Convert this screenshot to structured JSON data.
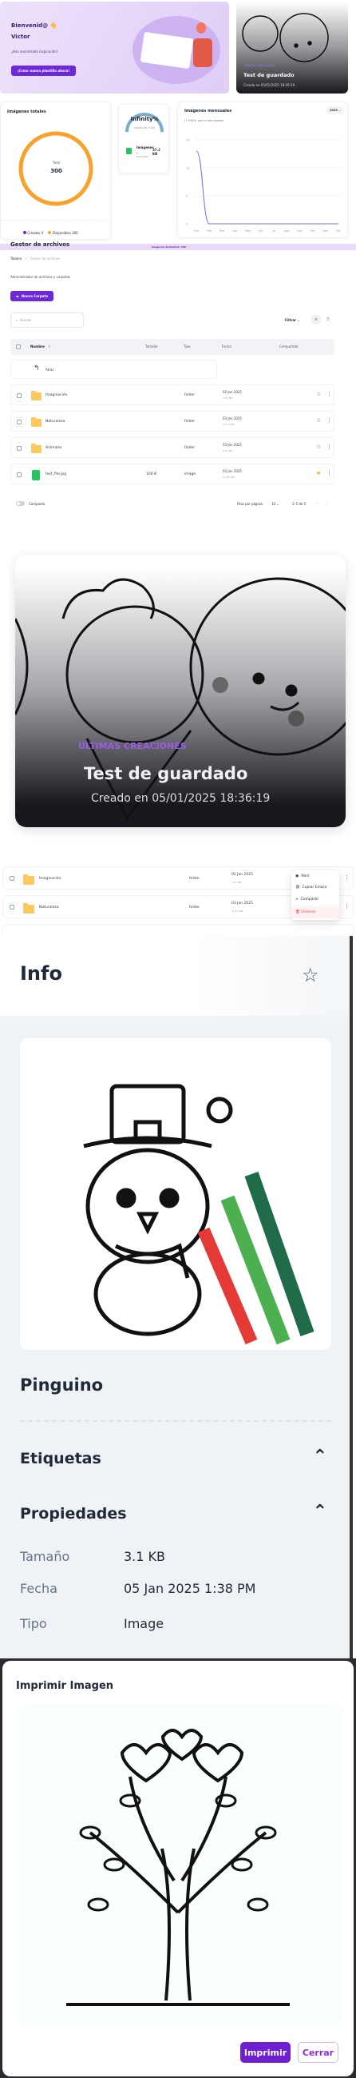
{
  "welcome": {
    "greeting": "Bienvenid@ 👋",
    "name": "Victor",
    "subtitle": "¿Has encontrado inspiración?",
    "cta": "¡Crear nueva plantilla ahora!"
  },
  "latest_small": {
    "eyebrow": "ÚLTIMAS CREACIONES",
    "title": "Test de guardado",
    "created": "Creado en 05/01/2025 18:36:19"
  },
  "total_images": {
    "title": "Imágenes totales",
    "center_label": "Total",
    "center_value": "300",
    "legend": [
      {
        "label": "Creadas 0",
        "color": "#6d28d9"
      },
      {
        "label": "Disponibles 300",
        "color": "#f9a12b"
      }
    ]
  },
  "storage": {
    "percent": "Infinity%",
    "used": "usado de 0 GB",
    "item_label": "Imágenes",
    "item_count": "0 archivos",
    "item_size": "37.2 KB"
  },
  "monthly": {
    "title": "Imágenes mensuales",
    "subtitle": "(+100%) que el año pasado",
    "year": "2025"
  },
  "chart_data": {
    "type": "line",
    "categories": [
      "Ene",
      "Feb",
      "Mar",
      "Abr",
      "May",
      "Jun",
      "Jul",
      "Ago",
      "Sep",
      "Oct",
      "Nov",
      "Dic"
    ],
    "values": [
      13,
      0,
      0,
      0,
      0,
      0,
      0,
      0,
      0,
      0,
      0,
      0
    ],
    "yticks": [
      "0",
      "5",
      "10",
      "15"
    ],
    "ylim": [
      0,
      15
    ],
    "grid": true,
    "color": "#8b5cf6"
  },
  "file_manager": {
    "title": "Gestor de archivos",
    "remaining": "Imágenes Restantes: 300",
    "breadcrumb": [
      "Tablero",
      "Gestor de archivos"
    ],
    "description": "Administrador de archivos y carpetas",
    "new_folder": "Nueva Carpeta",
    "search_placeholder": "Buscar",
    "filter": "Filtrar",
    "columns": [
      "Nombre",
      "Tamaño",
      "Tipo",
      "Fecha",
      "Compartido"
    ],
    "back": "Atrás",
    "rows": [
      {
        "name": "Imaginación",
        "size": "",
        "type": "folder",
        "date": "02 Jan 2025",
        "time": "7:31 PM",
        "starred": false
      },
      {
        "name": "Naturaleza",
        "size": "",
        "type": "folder",
        "date": "03 Jan 2025",
        "time": "11:14 AM",
        "starred": false
      },
      {
        "name": "Animales",
        "size": "",
        "type": "folder",
        "date": "03 Jan 2025",
        "time": "6:31 PM",
        "starred": false
      },
      {
        "name": "test_file.jpg",
        "size": "100 B",
        "type": "image",
        "date": "03 Jan 2025",
        "time": "11:05 AM",
        "starred": true
      }
    ],
    "compact": "Compacto",
    "rows_per_page_label": "Filas por página:",
    "rows_per_page": "10",
    "range": "1–5 de 5"
  },
  "carousel": {
    "eyebrow": "ÚLTIMAS CREACIONES",
    "title": "Test de guardado",
    "created": "Creado en 05/01/2025 18:36:19"
  },
  "context_rows": [
    {
      "name": "Imaginación",
      "type": "folder",
      "date": "02 Jan 2025",
      "time": "7:31 PM"
    },
    {
      "name": "Naturaleza",
      "type": "folder",
      "date": "03 Jan 2025",
      "time": "11:14 AM"
    }
  ],
  "context_menu": {
    "open": "Abrir",
    "copy_link": "Copiar Enlace",
    "share": "Compartir",
    "delete": "Eliminar"
  },
  "info": {
    "title": "Info",
    "file_name": "Pinguino",
    "tags": "Etiquetas",
    "properties": "Propiedades",
    "props": [
      {
        "label": "Tamaño",
        "value": "3.1 KB"
      },
      {
        "label": "Fecha",
        "value": "05 Jan 2025 1:38 PM"
      },
      {
        "label": "Tipo",
        "value": "Image"
      }
    ]
  },
  "print_dialog": {
    "title": "Imprimir Imagen",
    "print": "Imprimir",
    "close": "Cerrar"
  },
  "colors": {
    "primary": "#6d28d9",
    "orange": "#f9a12b",
    "danger": "#ef4444"
  }
}
